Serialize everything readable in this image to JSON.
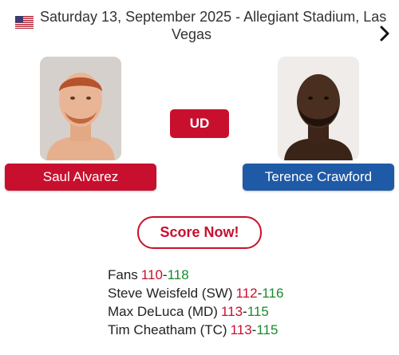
{
  "event": {
    "date_venue_line1": "Saturday 13, September 2025  -  Allegiant Stadium, Las",
    "date_venue_line2": "Vegas",
    "country_flag_icon": "us-flag-icon",
    "next_icon": "chevron-right-icon"
  },
  "fighters": {
    "left": {
      "name": "Saul Alvarez",
      "color": "#c8102e"
    },
    "right": {
      "name": "Terence Crawford",
      "color": "#1f5aa6"
    }
  },
  "result": {
    "method": "UD"
  },
  "score_now_label": "Score Now!",
  "scores": [
    {
      "judge": "Fans",
      "a": "110",
      "sep": "-",
      "b": "118"
    },
    {
      "judge": "Steve Weisfeld (SW)",
      "a": "112",
      "sep": "-",
      "b": "116"
    },
    {
      "judge": "Max DeLuca (MD)",
      "a": "113",
      "sep": "-",
      "b": "115"
    },
    {
      "judge": "Tim Cheatham (TC)",
      "a": "113",
      "sep": "-",
      "b": "115"
    }
  ],
  "colors": {
    "accent_red": "#c8102e",
    "accent_blue": "#1f5aa6",
    "score_green": "#1a8a2e"
  }
}
